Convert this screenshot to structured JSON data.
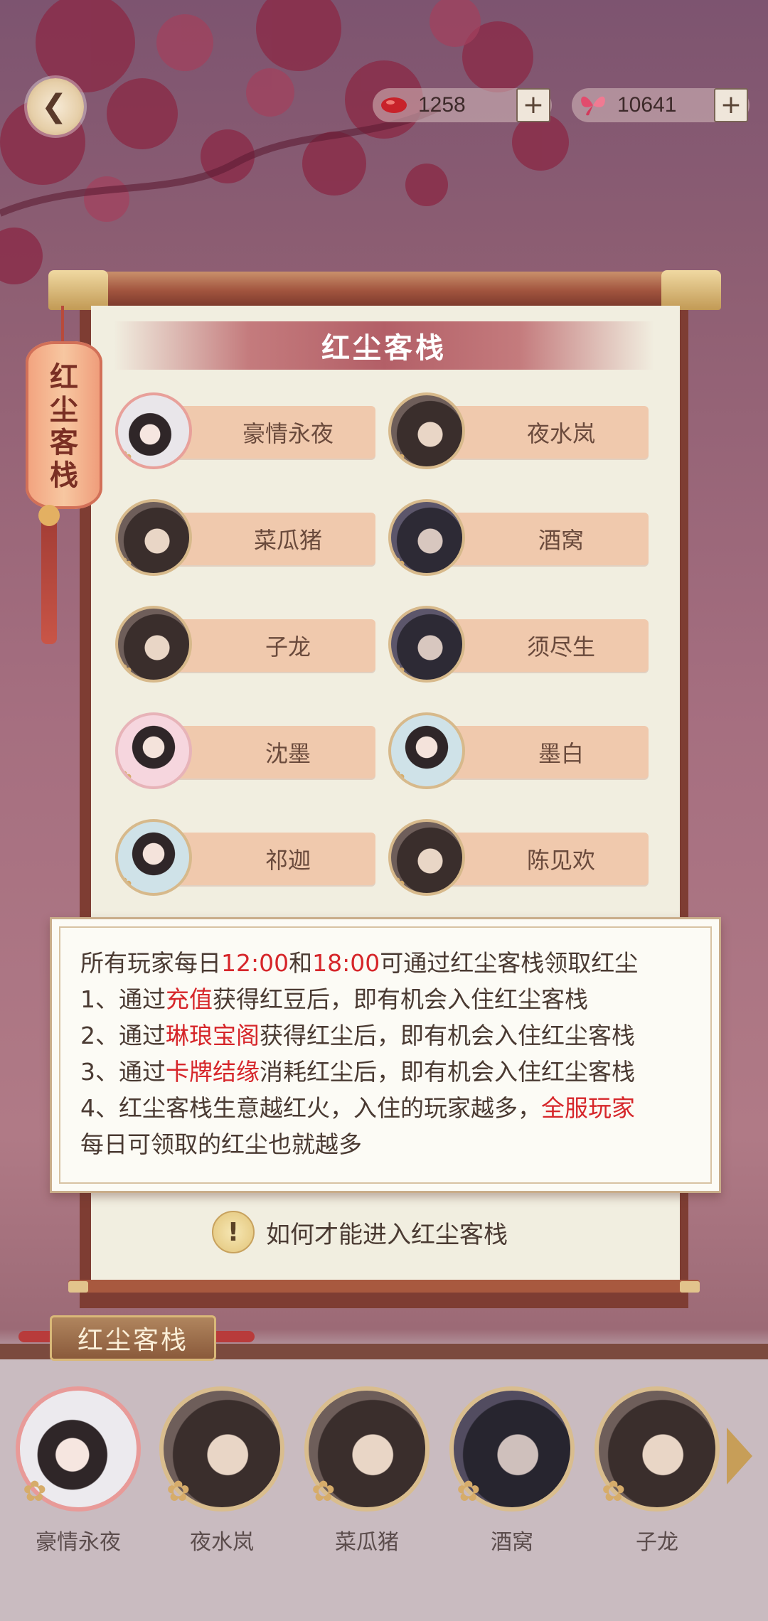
{
  "currencies": [
    {
      "icon": "red-bean-icon",
      "value": "1258",
      "plus": "+"
    },
    {
      "icon": "butterfly-icon",
      "value": "10641",
      "plus": "+"
    }
  ],
  "lantern_text": "红\n尘\n客\n栈",
  "panel_title": "红尘客栈",
  "members": [
    {
      "name": "豪情永夜",
      "avatar": "couple"
    },
    {
      "name": "夜水岚",
      "avatar": "male"
    },
    {
      "name": "菜瓜猪",
      "avatar": "male"
    },
    {
      "name": "酒窝",
      "avatar": "male2"
    },
    {
      "name": "子龙",
      "avatar": "male"
    },
    {
      "name": "须尽生",
      "avatar": "male2"
    },
    {
      "name": "沈墨",
      "avatar": "female"
    },
    {
      "name": "墨白",
      "avatar": "female2"
    },
    {
      "name": "祁迦",
      "avatar": "female2"
    },
    {
      "name": "陈见欢",
      "avatar": "male"
    }
  ],
  "rules": {
    "line0": {
      "a": "所有玩家每日",
      "t1": "12:00",
      "b": "和",
      "t2": "18:00",
      "c": "可通过红尘客栈领取红尘"
    },
    "line1": {
      "a": "1、通过",
      "hl": "充值",
      "b": "获得红豆后，即有机会入住红尘客栈"
    },
    "line2": {
      "a": "2、通过",
      "hl": "琳琅宝阁",
      "b": "获得红尘后，即有机会入住红尘客栈"
    },
    "line3": {
      "a": "3、通过",
      "hl": "卡牌结缘",
      "b": "消耗红尘后，即有机会入住红尘客栈"
    },
    "line4": {
      "a": "4、红尘客栈生意越红火，入住的玩家越多，",
      "hl": "全服玩家"
    },
    "line5": "每日可领取的红尘也就越多"
  },
  "how_to_label": "如何才能进入红尘客栈",
  "how_to_icon": "!",
  "bottom_tab": "红尘客栈",
  "bottom_players": [
    {
      "name": "豪情永夜",
      "avatar": "couple"
    },
    {
      "name": "夜水岚",
      "avatar": "male"
    },
    {
      "name": "菜瓜猪",
      "avatar": "male"
    },
    {
      "name": "酒窝",
      "avatar": "male2"
    },
    {
      "name": "子龙",
      "avatar": "male"
    }
  ],
  "colors": {
    "highlight": "#d6262a",
    "accent": "#b35f67"
  }
}
